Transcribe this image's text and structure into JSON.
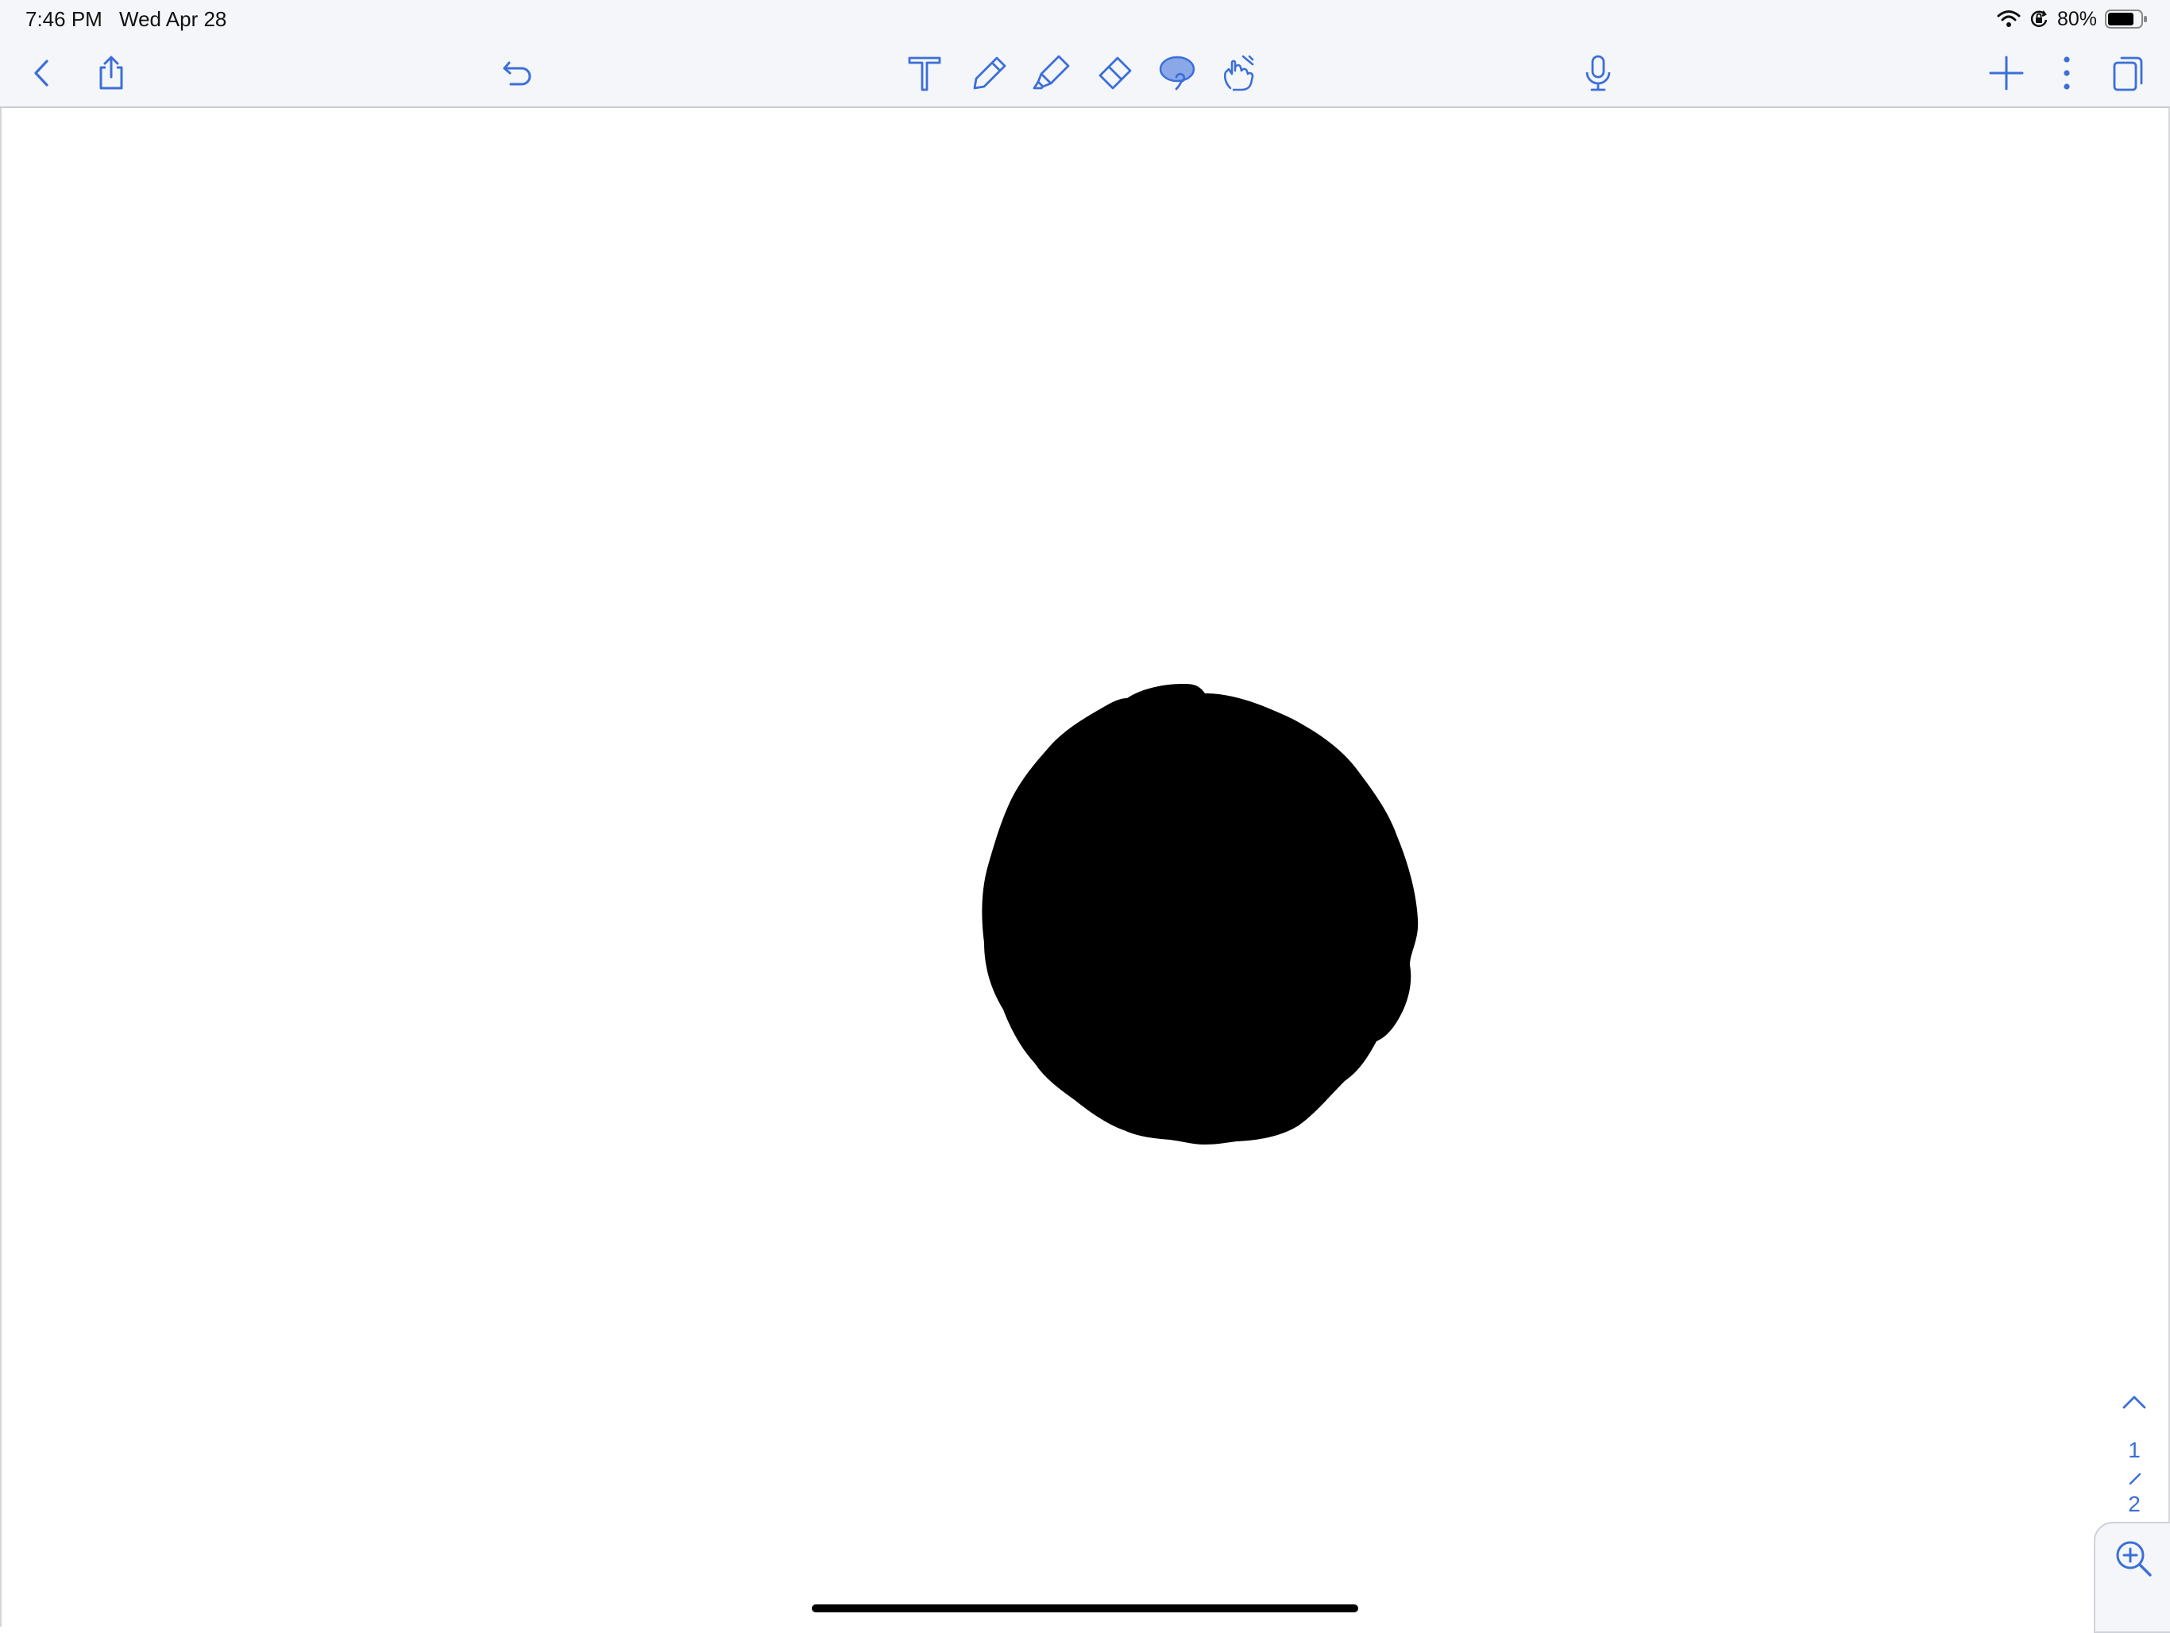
{
  "status_bar": {
    "time": "7:46 PM",
    "date": "Wed Apr 28",
    "battery_percent": "80%",
    "battery_level": 0.8,
    "icons": [
      "wifi-icon",
      "orientation-lock-icon",
      "battery-icon"
    ]
  },
  "toolbar": {
    "left": [
      "back-chevron-icon",
      "share-icon"
    ],
    "undo": "undo-icon",
    "tools": [
      "text-tool-icon",
      "pen-tool-icon",
      "highlighter-tool-icon",
      "eraser-tool-icon",
      "lasso-tool-icon",
      "hand-tool-icon"
    ],
    "active_tool": "lasso-tool",
    "microphone": "microphone-icon",
    "right": [
      "add-icon",
      "more-options-icon",
      "pages-icon"
    ]
  },
  "page_navigator": {
    "current_page": "1",
    "total_pages": "2"
  },
  "zoom": {
    "icon": "zoom-in-icon"
  },
  "colors": {
    "accent": "#3b6fd8",
    "toolbar_bg": "#f5f6fa",
    "active_tool_fill": "#8aa8e8",
    "ink": "#000000"
  }
}
